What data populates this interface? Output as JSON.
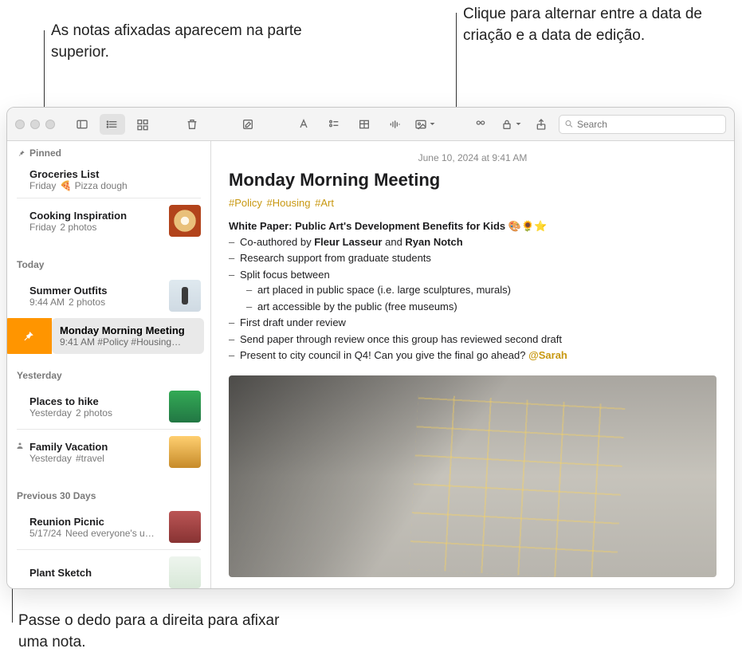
{
  "callouts": {
    "top_left": "As notas afixadas aparecem na parte superior.",
    "top_right": "Clique para alternar entre a data de criação e a data de edição.",
    "bottom": "Passe o dedo para a direita para afixar uma nota."
  },
  "toolbar": {
    "search_placeholder": "Search"
  },
  "sidebar": {
    "sections": {
      "pinned": "Pinned",
      "today": "Today",
      "yesterday": "Yesterday",
      "previous30": "Previous 30 Days"
    },
    "pinned": [
      {
        "title": "Groceries List",
        "date": "Friday",
        "preview": "🍕 Pizza dough"
      },
      {
        "title": "Cooking Inspiration",
        "date": "Friday",
        "preview": "2 photos"
      }
    ],
    "today": [
      {
        "title": "Summer Outfits",
        "date": "9:44 AM",
        "preview": "2 photos"
      },
      {
        "title": "Monday Morning Meeting",
        "date": "9:41 AM",
        "preview": "#Policy #Housing…",
        "selected": true
      }
    ],
    "yesterday": [
      {
        "title": "Places to hike",
        "date": "Yesterday",
        "preview": "2 photos"
      },
      {
        "title": "Family Vacation",
        "date": "Yesterday",
        "preview": "#travel",
        "shared": true
      }
    ],
    "previous30": [
      {
        "title": "Reunion Picnic",
        "date": "5/17/24",
        "preview": "Need everyone's u…"
      },
      {
        "title": "Plant Sketch",
        "date": "",
        "preview": ""
      }
    ]
  },
  "note": {
    "date": "June 10, 2024 at 9:41 AM",
    "title": "Monday Morning Meeting",
    "tags": [
      "#Policy",
      "#Housing",
      "#Art"
    ],
    "heading": "White Paper: Public Art's Development Benefits for Kids 🎨🌻⭐️",
    "bullets": {
      "b1_pre": "Co-authored by ",
      "b1_a": "Fleur Lasseur",
      "b1_and": " and ",
      "b1_b": "Ryan Notch",
      "b2": "Research support from graduate students",
      "b3": "Split focus between",
      "b3a": "art placed in public space (i.e. large sculptures, murals)",
      "b3b": "art accessible by the public (free museums)",
      "b4": "First draft under review",
      "b5": "Send paper through review once this group has reviewed second draft",
      "b6_pre": "Present to city council in Q4! Can you give the final go ahead? ",
      "b6_mention": "@Sarah"
    }
  }
}
